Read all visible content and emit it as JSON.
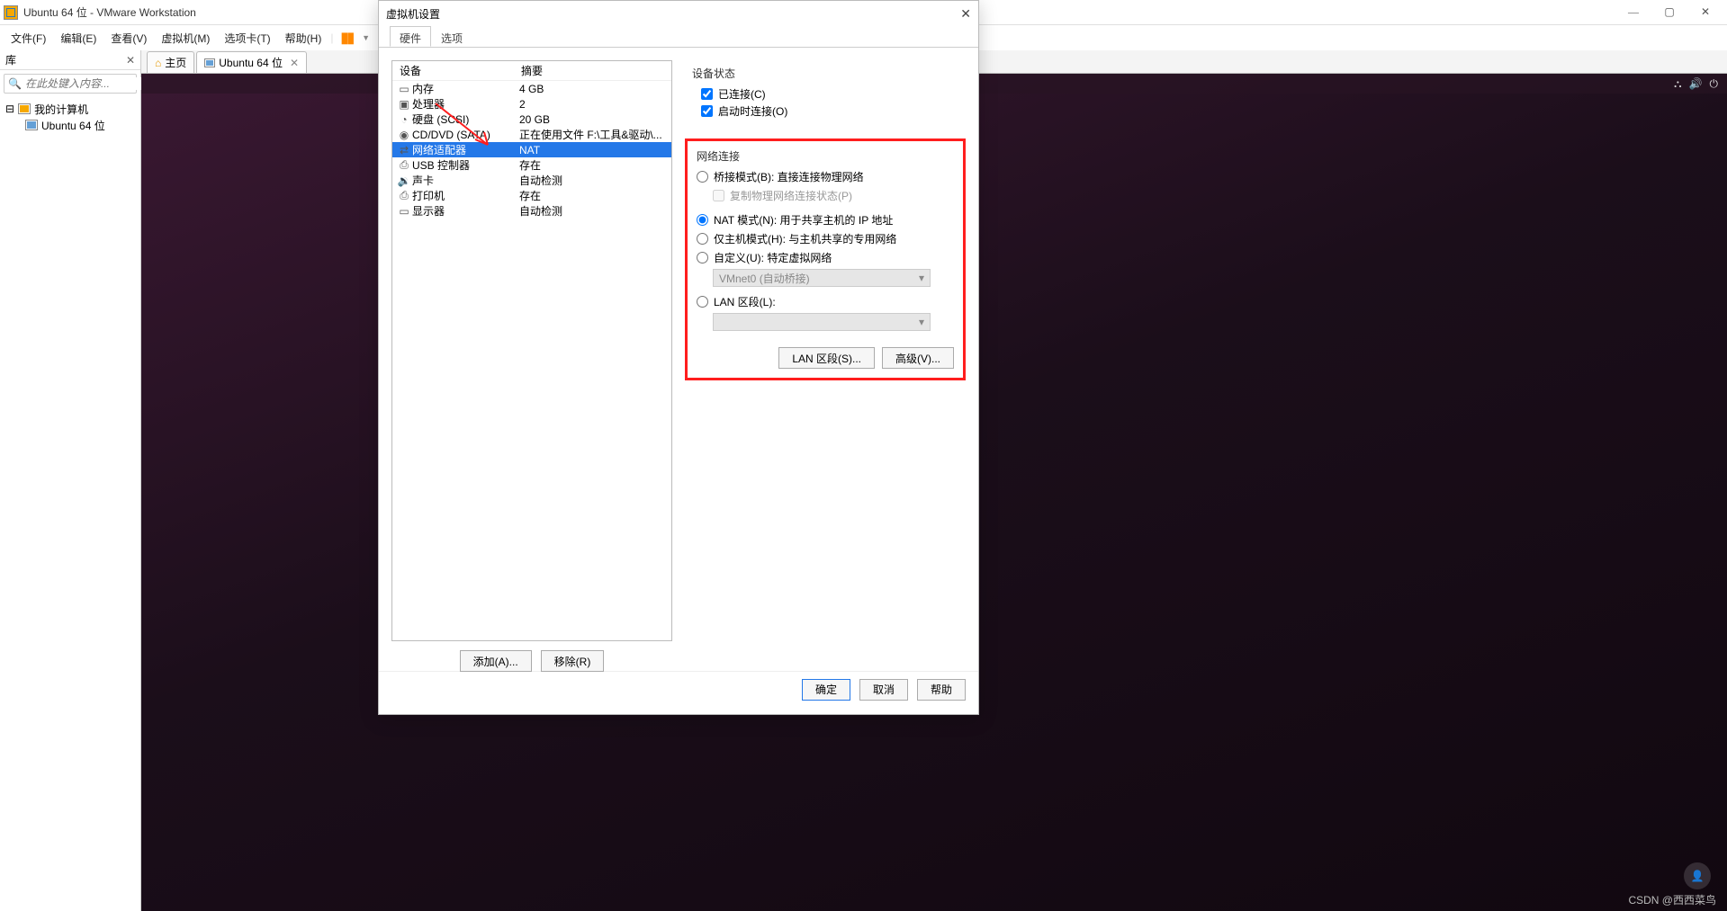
{
  "window": {
    "title": "Ubuntu 64 位 - VMware Workstation"
  },
  "menubar": {
    "file": "文件(F)",
    "edit": "编辑(E)",
    "view": "查看(V)",
    "vm": "虚拟机(M)",
    "tabs": "选项卡(T)",
    "help": "帮助(H)"
  },
  "sidebar": {
    "title": "库",
    "search_placeholder": "在此处键入内容...",
    "tree": {
      "root": "我的计算机",
      "child": "Ubuntu 64 位"
    }
  },
  "tabs": {
    "home": "主页",
    "vm": "Ubuntu 64 位"
  },
  "dialog": {
    "title": "虚拟机设置",
    "tabs": {
      "hardware": "硬件",
      "options": "选项"
    },
    "headers": {
      "device": "设备",
      "summary": "摘要"
    },
    "hw": [
      {
        "icon": "▭",
        "name": "内存",
        "summary": "4 GB"
      },
      {
        "icon": "▣",
        "name": "处理器",
        "summary": "2"
      },
      {
        "icon": "◔",
        "name": "硬盘 (SCSI)",
        "summary": "20 GB"
      },
      {
        "icon": "◉",
        "name": "CD/DVD (SATA)",
        "summary": "正在使用文件 F:\\工具&驱动\\..."
      },
      {
        "icon": "⇄",
        "name": "网络适配器",
        "summary": "NAT"
      },
      {
        "icon": "⎙",
        "name": "USB 控制器",
        "summary": "存在"
      },
      {
        "icon": "🔉",
        "name": "声卡",
        "summary": "自动检测"
      },
      {
        "icon": "⎙",
        "name": "打印机",
        "summary": "存在"
      },
      {
        "icon": "▭",
        "name": "显示器",
        "summary": "自动检测"
      }
    ],
    "add": "添加(A)...",
    "remove": "移除(R)",
    "device_status": {
      "label": "设备状态",
      "connected": "已连接(C)",
      "connect_on_poweron": "启动时连接(O)"
    },
    "network": {
      "label": "网络连接",
      "bridge": "桥接模式(B): 直接连接物理网络",
      "replicate": "复制物理网络连接状态(P)",
      "nat": "NAT 模式(N): 用于共享主机的 IP 地址",
      "hostonly": "仅主机模式(H): 与主机共享的专用网络",
      "custom": "自定义(U): 特定虚拟网络",
      "custom_value": "VMnet0 (自动桥接)",
      "lan_segment": "LAN 区段(L):",
      "lan_button": "LAN 区段(S)...",
      "advanced": "高级(V)..."
    },
    "footer": {
      "ok": "确定",
      "cancel": "取消",
      "help": "帮助"
    }
  },
  "watermark": "CSDN @西西菜鸟"
}
